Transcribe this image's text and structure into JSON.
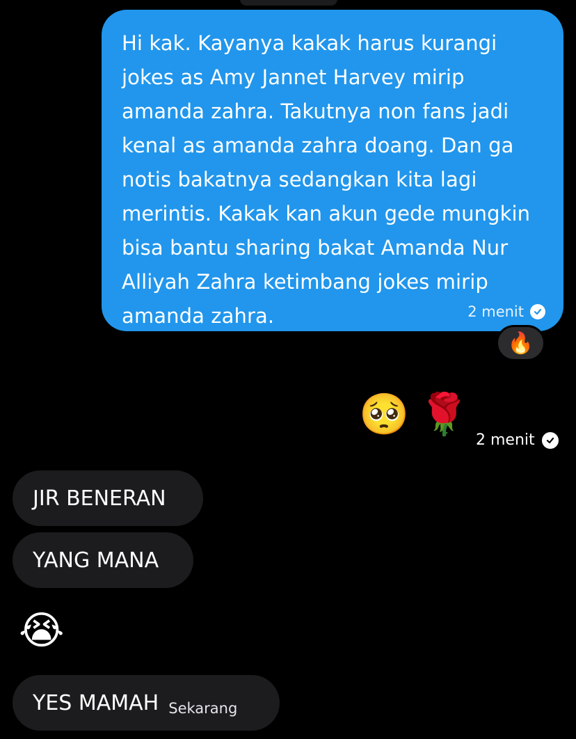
{
  "outgoing_message": {
    "text": "Hi kak. Kayanya kakak harus kurangi jokes as Amy Jannet Harvey mirip amanda zahra. Takutnya non fans jadi kenal as amanda zahra doang. Dan ga notis bakatnya sedangkan kita lagi merintis. Kakak kan akun gede mungkin bisa bantu sharing bakat Amanda Nur Alliyah Zahra ketimbang jokes mirip amanda zahra.",
    "time": "2 menit",
    "reaction": "🔥",
    "bubble_color": "#2196ec"
  },
  "outgoing_emojis": {
    "first": "🥺",
    "second": "🌹",
    "time": "2 menit"
  },
  "incoming_messages": [
    {
      "text": "JIR BENERAN"
    },
    {
      "text": "YANG MANA"
    },
    {
      "emoji": "😭"
    },
    {
      "text": "YES MAMAH",
      "time": "Sekarang"
    }
  ],
  "colors": {
    "background": "#000000",
    "incoming_bubble": "#1c1c1e",
    "reaction_pill": "#2c2c2e"
  }
}
